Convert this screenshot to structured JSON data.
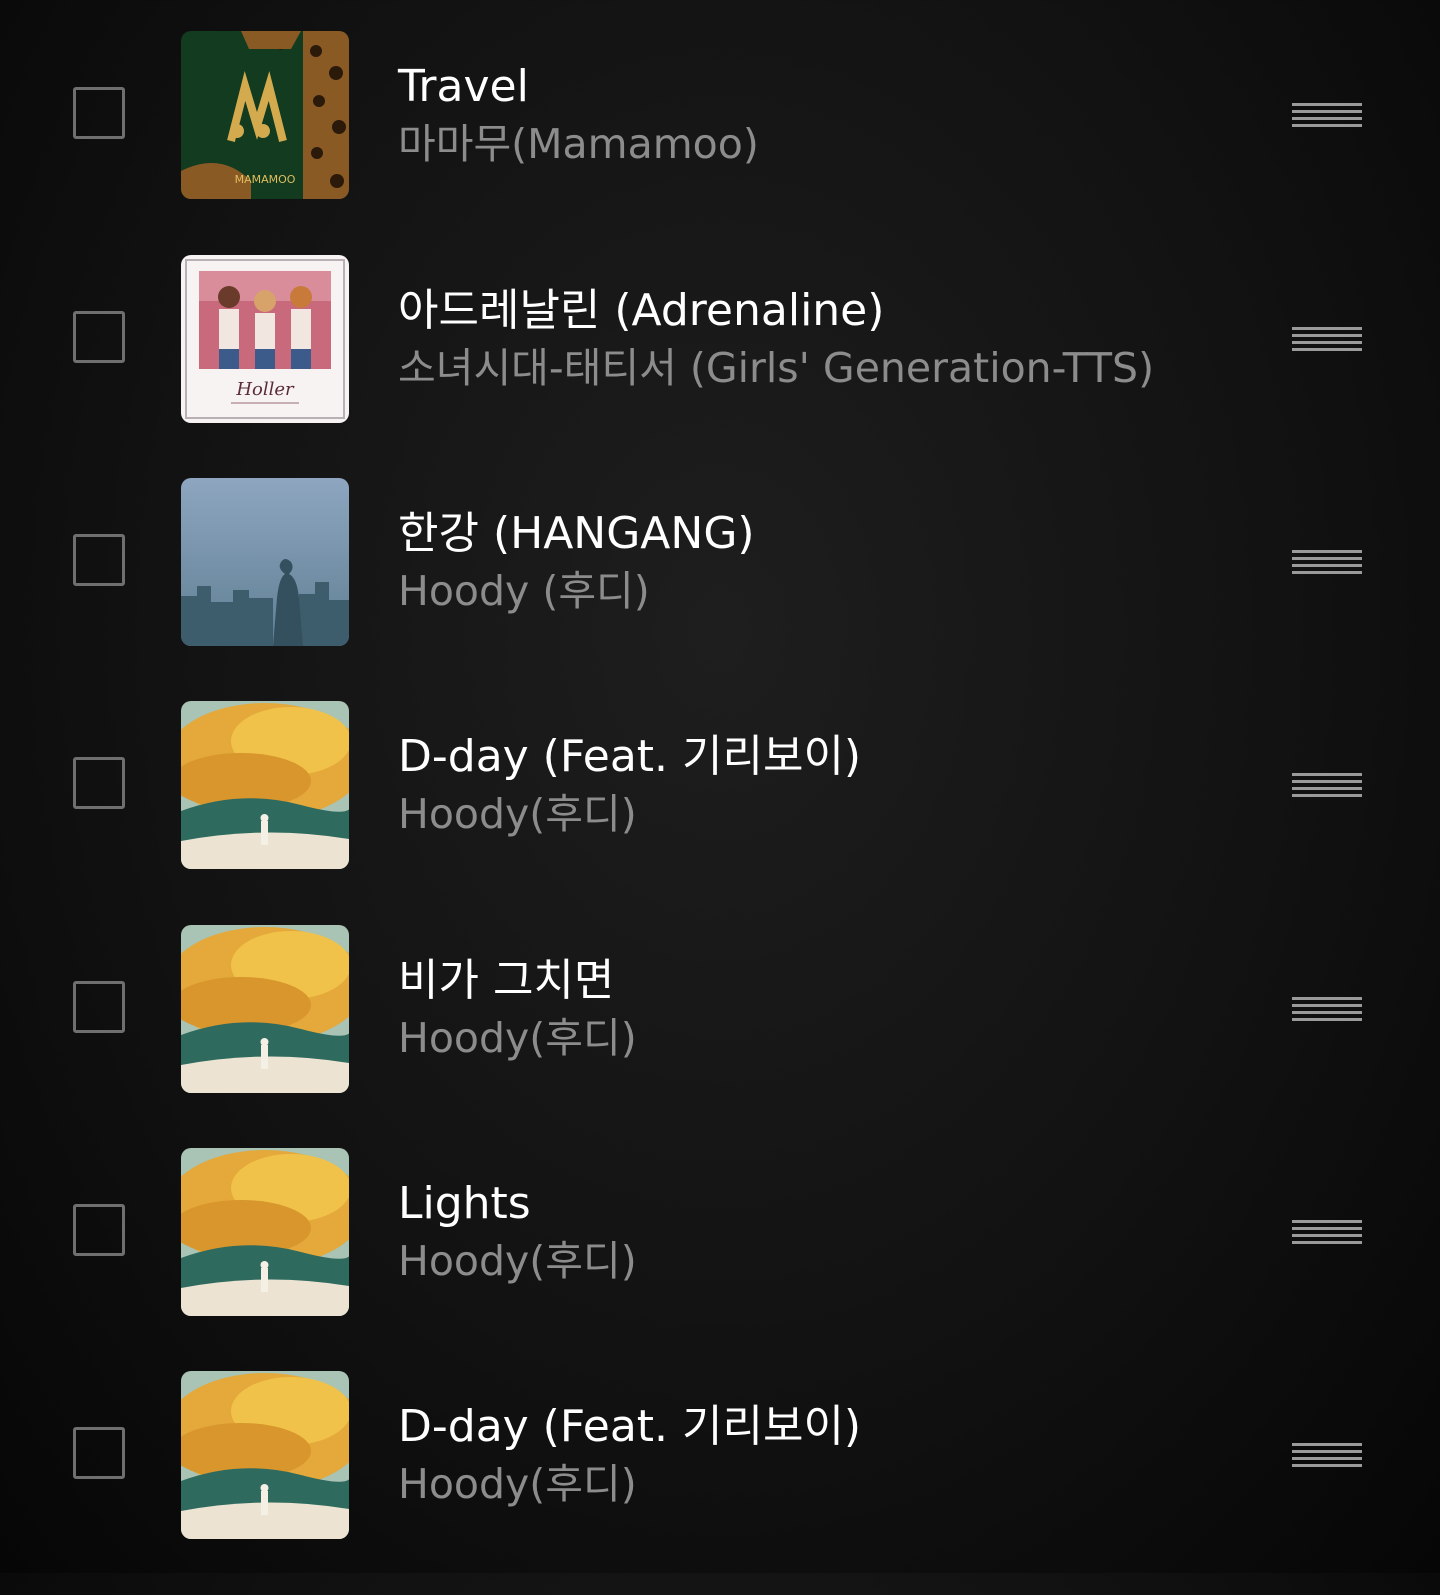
{
  "tracks": [
    {
      "title": "Travel",
      "artist": "마마무(Mamamoo)",
      "art": "mamamoo-travel-cover",
      "art_text": "MAMAMOO"
    },
    {
      "title": "아드레날린 (Adrenaline)",
      "artist": "소녀시대-태티서 (Girls' Generation-TTS)",
      "art": "holler-cover",
      "art_text": "Holler"
    },
    {
      "title": "한강 (HANGANG)",
      "artist": "Hoody (후디)",
      "art": "hangang-cover",
      "art_text": ""
    },
    {
      "title": "D-day (Feat. 기리보이)",
      "artist": "Hoody(후디)",
      "art": "on-and-on-cover",
      "art_text": ""
    },
    {
      "title": "비가 그치면",
      "artist": "Hoody(후디)",
      "art": "on-and-on-cover",
      "art_text": ""
    },
    {
      "title": "Lights",
      "artist": "Hoody(후디)",
      "art": "on-and-on-cover",
      "art_text": ""
    },
    {
      "title": "D-day (Feat. 기리보이)",
      "artist": "Hoody(후디)",
      "art": "on-and-on-cover",
      "art_text": ""
    }
  ],
  "colors": {
    "background": "#121212",
    "title": "#ffffff",
    "artist": "#8c8c8c",
    "control": "#6f6f6f"
  },
  "icons": {
    "checkbox": "checkbox-unchecked-icon",
    "drag": "drag-handle-icon"
  }
}
